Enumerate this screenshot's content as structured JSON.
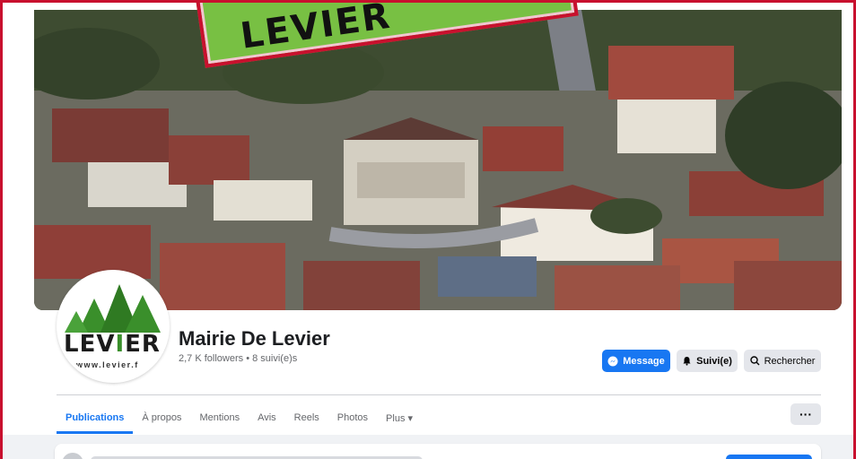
{
  "banner": {
    "text": "LEVIER"
  },
  "profile": {
    "logo_text_left": "LEV",
    "logo_text_i": "I",
    "logo_text_right": "ER",
    "logo_url": "www.levier.f",
    "name": "Mairie De Levier",
    "followers": "2,7 K followers • 8 suivi(e)s"
  },
  "actions": {
    "message": "Message",
    "follow": "Suivi(e)",
    "search": "Rechercher"
  },
  "tabs": [
    "Publications",
    "À propos",
    "Mentions",
    "Avis",
    "Reels",
    "Photos",
    "Plus ▾"
  ],
  "more_label": "···",
  "colors": {
    "accent": "#1877f2",
    "banner_green": "#78c043",
    "frame_red": "#c8102e"
  }
}
